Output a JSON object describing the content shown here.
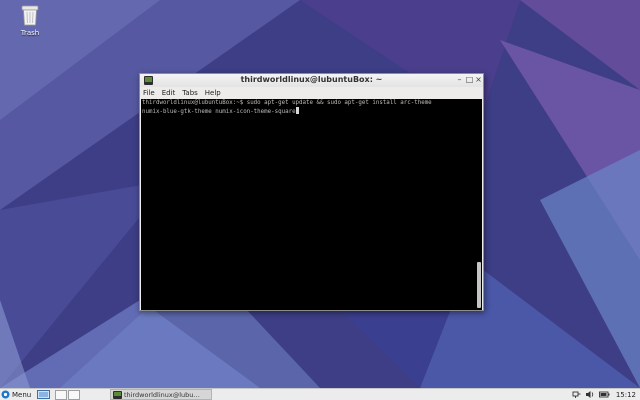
{
  "desktop": {
    "icons": [
      {
        "label": "Trash",
        "icon": "trash-icon"
      }
    ]
  },
  "terminal": {
    "title": "thirdworldlinux@lubuntuBox: ~",
    "icon": "terminal-icon",
    "menu": [
      "File",
      "Edit",
      "Tabs",
      "Help"
    ],
    "lines": [
      "thirdworldlinux@lubuntuBox:~$ sudo apt-get update && sudo apt-get install arc-theme",
      "numix-blue-gtk-theme numix-icon-theme-square"
    ],
    "controls": {
      "minimize": "–",
      "maximize": "□",
      "close": "×"
    }
  },
  "taskbar": {
    "menu_label": "Menu",
    "task_label": "thirdworldlinux@lubu…",
    "clock": "15:12",
    "tray_icons": [
      "network-icon",
      "volume-icon",
      "battery-icon"
    ]
  },
  "colors": {
    "wallpaper_base": "#3d3e86",
    "terminal_background": "#000000",
    "terminal_text": "#bcbcbc"
  }
}
